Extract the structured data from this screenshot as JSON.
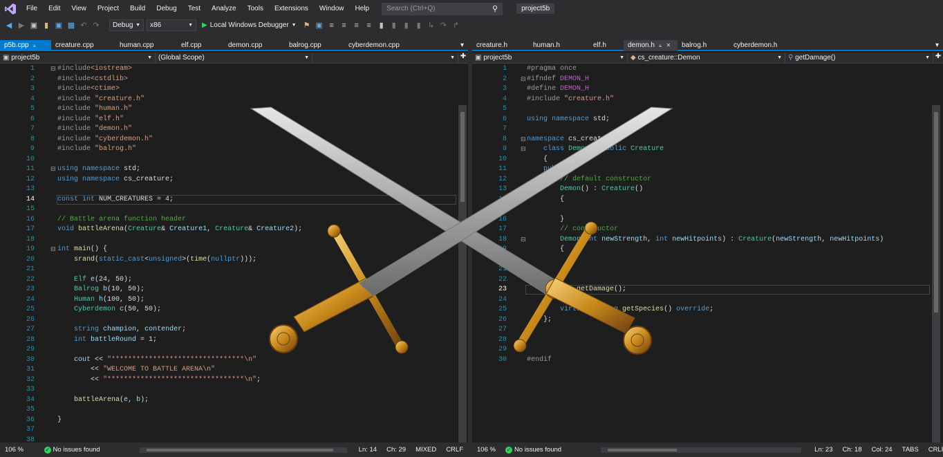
{
  "menubar": {
    "items": [
      "File",
      "Edit",
      "View",
      "Project",
      "Build",
      "Debug",
      "Test",
      "Analyze",
      "Tools",
      "Extensions",
      "Window",
      "Help"
    ],
    "search_placeholder": "Search (Ctrl+Q)",
    "solution_name": "project5b"
  },
  "toolbar": {
    "config": "Debug",
    "platform": "x86",
    "run_label": "Local Windows Debugger"
  },
  "left": {
    "tabs": [
      {
        "label": "p5b.cpp",
        "active": true
      },
      {
        "label": "creature.cpp"
      },
      {
        "label": "human.cpp"
      },
      {
        "label": "elf.cpp"
      },
      {
        "label": "demon.cpp"
      },
      {
        "label": "balrog.cpp"
      },
      {
        "label": "cyberdemon.cpp"
      }
    ],
    "nav_project": "project5b",
    "nav_scope": "(Global Scope)",
    "status": {
      "zoom": "106 %",
      "issues": "No issues found",
      "ln": "Ln: 14",
      "ch": "Ch: 29",
      "eol_mode": "MIXED",
      "eol": "CRLF"
    }
  },
  "right": {
    "tabs": [
      {
        "label": "creature.h"
      },
      {
        "label": "human.h"
      },
      {
        "label": "elf.h"
      },
      {
        "label": "demon.h",
        "active": true
      },
      {
        "label": "balrog.h"
      },
      {
        "label": "cyberdemon.h"
      }
    ],
    "nav_project": "project5b",
    "nav_class": "cs_creature::Demon",
    "nav_member": "getDamage()",
    "status": {
      "zoom": "106 %",
      "issues": "No issues found",
      "ln": "Ln: 23",
      "ch": "Ch: 18",
      "col": "Col: 24",
      "tabs": "TABS",
      "eol": "CRLF"
    }
  },
  "left_code": [
    {
      "n": 1,
      "t": [
        [
          "pp",
          "#include"
        ],
        [
          "st",
          "<iostream>"
        ]
      ],
      "fold": "box"
    },
    {
      "n": 2,
      "t": [
        [
          "pp",
          "#include"
        ],
        [
          "st",
          "<cstdlib>"
        ]
      ]
    },
    {
      "n": 3,
      "t": [
        [
          "pp",
          "#include"
        ],
        [
          "st",
          "<ctime>"
        ]
      ]
    },
    {
      "n": 4,
      "t": [
        [
          "pp",
          "#include "
        ],
        [
          "st",
          "\"creature.h\""
        ]
      ]
    },
    {
      "n": 5,
      "t": [
        [
          "pp",
          "#include "
        ],
        [
          "st",
          "\"human.h\""
        ]
      ]
    },
    {
      "n": 6,
      "t": [
        [
          "pp",
          "#include "
        ],
        [
          "st",
          "\"elf.h\""
        ]
      ]
    },
    {
      "n": 7,
      "t": [
        [
          "pp",
          "#include "
        ],
        [
          "st",
          "\"demon.h\""
        ]
      ]
    },
    {
      "n": 8,
      "t": [
        [
          "pp",
          "#include "
        ],
        [
          "st",
          "\"cyberdemon.h\""
        ]
      ]
    },
    {
      "n": 9,
      "t": [
        [
          "pp",
          "#include "
        ],
        [
          "st",
          "\"balrog.h\""
        ]
      ]
    },
    {
      "n": 10,
      "t": []
    },
    {
      "n": 11,
      "t": [
        [
          "kw",
          "using namespace "
        ],
        [
          "pl",
          "std;"
        ]
      ],
      "fold": "box"
    },
    {
      "n": 12,
      "t": [
        [
          "kw",
          "using namespace "
        ],
        [
          "pl",
          "cs_creature;"
        ]
      ]
    },
    {
      "n": 13,
      "t": []
    },
    {
      "n": 14,
      "t": [
        [
          "kw",
          "const int "
        ],
        [
          "pl",
          "NUM_CREATURES = 4;"
        ]
      ],
      "cur": true
    },
    {
      "n": 15,
      "t": []
    },
    {
      "n": 16,
      "t": [
        [
          "cm",
          "// Battle arena function header"
        ]
      ]
    },
    {
      "n": 17,
      "t": [
        [
          "kw",
          "void "
        ],
        [
          "fn",
          "battleArena"
        ],
        [
          "pl",
          "("
        ],
        [
          "ty",
          "Creature"
        ],
        [
          "pl",
          "& "
        ],
        [
          "vr",
          "Creature1"
        ],
        [
          "pl",
          ", "
        ],
        [
          "ty",
          "Creature"
        ],
        [
          "pl",
          "& "
        ],
        [
          "vr",
          "Creature2"
        ],
        [
          "pl",
          ");"
        ]
      ]
    },
    {
      "n": 18,
      "t": []
    },
    {
      "n": 19,
      "t": [
        [
          "kw",
          "int "
        ],
        [
          "fn",
          "main"
        ],
        [
          "pl",
          "() {"
        ]
      ],
      "fold": "box"
    },
    {
      "n": 20,
      "t": [
        [
          "pl",
          "    "
        ],
        [
          "fn",
          "srand"
        ],
        [
          "pl",
          "("
        ],
        [
          "kw",
          "static_cast"
        ],
        [
          "pl",
          "<"
        ],
        [
          "kw",
          "unsigned"
        ],
        [
          "pl",
          ">("
        ],
        [
          "fn",
          "time"
        ],
        [
          "pl",
          "("
        ],
        [
          "kw",
          "nullptr"
        ],
        [
          "pl",
          ")));"
        ]
      ]
    },
    {
      "n": 21,
      "t": []
    },
    {
      "n": 22,
      "t": [
        [
          "pl",
          "    "
        ],
        [
          "ty",
          "Elf "
        ],
        [
          "vr",
          "e"
        ],
        [
          "pl",
          "(24, 50);"
        ]
      ]
    },
    {
      "n": 23,
      "t": [
        [
          "pl",
          "    "
        ],
        [
          "ty",
          "Balrog "
        ],
        [
          "vr",
          "b"
        ],
        [
          "pl",
          "(10, 50);"
        ]
      ]
    },
    {
      "n": 24,
      "t": [
        [
          "pl",
          "    "
        ],
        [
          "ty",
          "Human "
        ],
        [
          "vr",
          "h"
        ],
        [
          "pl",
          "(100, 50);"
        ]
      ]
    },
    {
      "n": 25,
      "t": [
        [
          "pl",
          "    "
        ],
        [
          "ty",
          "Cyberdemon "
        ],
        [
          "vr",
          "c"
        ],
        [
          "pl",
          "(50, 50);"
        ]
      ]
    },
    {
      "n": 26,
      "t": []
    },
    {
      "n": 27,
      "t": [
        [
          "pl",
          "    "
        ],
        [
          "kw",
          "string "
        ],
        [
          "vr",
          "champion"
        ],
        [
          "pl",
          ", "
        ],
        [
          "vr",
          "contender"
        ],
        [
          "pl",
          ";"
        ]
      ]
    },
    {
      "n": 28,
      "t": [
        [
          "pl",
          "    "
        ],
        [
          "kw",
          "int "
        ],
        [
          "vr",
          "battleRound"
        ],
        [
          "pl",
          " = 1;"
        ]
      ]
    },
    {
      "n": 29,
      "t": []
    },
    {
      "n": 30,
      "t": [
        [
          "pl",
          "    "
        ],
        [
          "vr",
          "cout"
        ],
        [
          "pl",
          " << "
        ],
        [
          "st",
          "\"********************************\\n\""
        ]
      ]
    },
    {
      "n": 31,
      "t": [
        [
          "pl",
          "        << "
        ],
        [
          "st",
          "\"WELCOME TO BATTLE ARENA\\n\""
        ]
      ]
    },
    {
      "n": 32,
      "t": [
        [
          "pl",
          "        << "
        ],
        [
          "st",
          "\"*********************************\\n\""
        ],
        [
          "pl",
          ";"
        ]
      ]
    },
    {
      "n": 33,
      "t": []
    },
    {
      "n": 34,
      "t": [
        [
          "pl",
          "    "
        ],
        [
          "fn",
          "battleArena"
        ],
        [
          "pl",
          "("
        ],
        [
          "vr",
          "e"
        ],
        [
          "pl",
          ", "
        ],
        [
          "vr",
          "b"
        ],
        [
          "pl",
          ");"
        ]
      ]
    },
    {
      "n": 35,
      "t": []
    },
    {
      "n": 36,
      "t": [
        [
          "pl",
          "}"
        ]
      ]
    },
    {
      "n": 37,
      "t": []
    },
    {
      "n": 38,
      "t": []
    }
  ],
  "right_code": [
    {
      "n": 1,
      "t": [
        [
          "pp",
          "#pragma once"
        ]
      ]
    },
    {
      "n": 2,
      "t": [
        [
          "pp",
          "#ifndef "
        ],
        [
          "mac",
          "DEMON_H"
        ]
      ],
      "fold": "box"
    },
    {
      "n": 3,
      "t": [
        [
          "pp",
          "#define "
        ],
        [
          "mac",
          "DEMON_H"
        ]
      ]
    },
    {
      "n": 4,
      "t": [
        [
          "pp",
          "#include "
        ],
        [
          "st",
          "\"creature.h\""
        ]
      ]
    },
    {
      "n": 5,
      "t": []
    },
    {
      "n": 6,
      "t": [
        [
          "kw",
          "using namespace "
        ],
        [
          "pl",
          "std;"
        ]
      ]
    },
    {
      "n": 7,
      "t": []
    },
    {
      "n": 8,
      "t": [
        [
          "kw",
          "namespace "
        ],
        [
          "pl",
          "cs_creature"
        ]
      ],
      "fold": "box"
    },
    {
      "n": 9,
      "t": [
        [
          "pl",
          "    "
        ],
        [
          "kw",
          "class "
        ],
        [
          "ty",
          "Demon"
        ],
        [
          "pl",
          " : "
        ],
        [
          "kw",
          "public "
        ],
        [
          "ty",
          "Creature"
        ]
      ],
      "fold": "box"
    },
    {
      "n": 10,
      "t": [
        [
          "pl",
          "    {"
        ]
      ]
    },
    {
      "n": 11,
      "t": [
        [
          "pl",
          "    "
        ],
        [
          "kw",
          "public"
        ],
        [
          "pl",
          ":"
        ]
      ]
    },
    {
      "n": 12,
      "t": [
        [
          "pl",
          "        "
        ],
        [
          "cm",
          "// default constructor"
        ]
      ]
    },
    {
      "n": 13,
      "t": [
        [
          "pl",
          "        "
        ],
        [
          "ty",
          "Demon"
        ],
        [
          "pl",
          "() : "
        ],
        [
          "ty",
          "Creature"
        ],
        [
          "pl",
          "()"
        ]
      ]
    },
    {
      "n": 14,
      "t": [
        [
          "pl",
          "        {"
        ]
      ]
    },
    {
      "n": 15,
      "t": []
    },
    {
      "n": 16,
      "t": [
        [
          "pl",
          "        }"
        ]
      ]
    },
    {
      "n": 17,
      "t": [
        [
          "pl",
          "        "
        ],
        [
          "cm",
          "// constructor"
        ]
      ]
    },
    {
      "n": 18,
      "t": [
        [
          "pl",
          "        "
        ],
        [
          "ty",
          "Demon"
        ],
        [
          "pl",
          "("
        ],
        [
          "kw",
          "int "
        ],
        [
          "vr",
          "newStrength"
        ],
        [
          "pl",
          ", "
        ],
        [
          "kw",
          "int "
        ],
        [
          "vr",
          "newHitpoints"
        ],
        [
          "pl",
          ") : "
        ],
        [
          "ty",
          "Creature"
        ],
        [
          "pl",
          "("
        ],
        [
          "vr",
          "newStrength"
        ],
        [
          "pl",
          ", "
        ],
        [
          "vr",
          "newHitpoints"
        ],
        [
          "pl",
          ")"
        ]
      ],
      "fold": "box"
    },
    {
      "n": 19,
      "t": [
        [
          "pl",
          "        {"
        ]
      ]
    },
    {
      "n": 20,
      "t": []
    },
    {
      "n": 21,
      "t": []
    },
    {
      "n": 22,
      "t": []
    },
    {
      "n": 23,
      "t": [
        [
          "pl",
          "        "
        ],
        [
          "kw",
          "int "
        ],
        [
          "fn",
          "getDamage"
        ],
        [
          "pl",
          "();"
        ]
      ],
      "cur": true
    },
    {
      "n": 24,
      "t": []
    },
    {
      "n": 25,
      "t": [
        [
          "pl",
          "        "
        ],
        [
          "kw",
          "virtual "
        ],
        [
          "kw",
          "string "
        ],
        [
          "fn",
          "getSpecies"
        ],
        [
          "pl",
          "() "
        ],
        [
          "kw",
          "override"
        ],
        [
          "pl",
          ";"
        ]
      ]
    },
    {
      "n": 26,
      "t": [
        [
          "pl",
          "    };"
        ]
      ]
    },
    {
      "n": 27,
      "t": []
    },
    {
      "n": 28,
      "t": []
    },
    {
      "n": 29,
      "t": []
    },
    {
      "n": 30,
      "t": [
        [
          "pp",
          "#endif"
        ]
      ]
    }
  ]
}
